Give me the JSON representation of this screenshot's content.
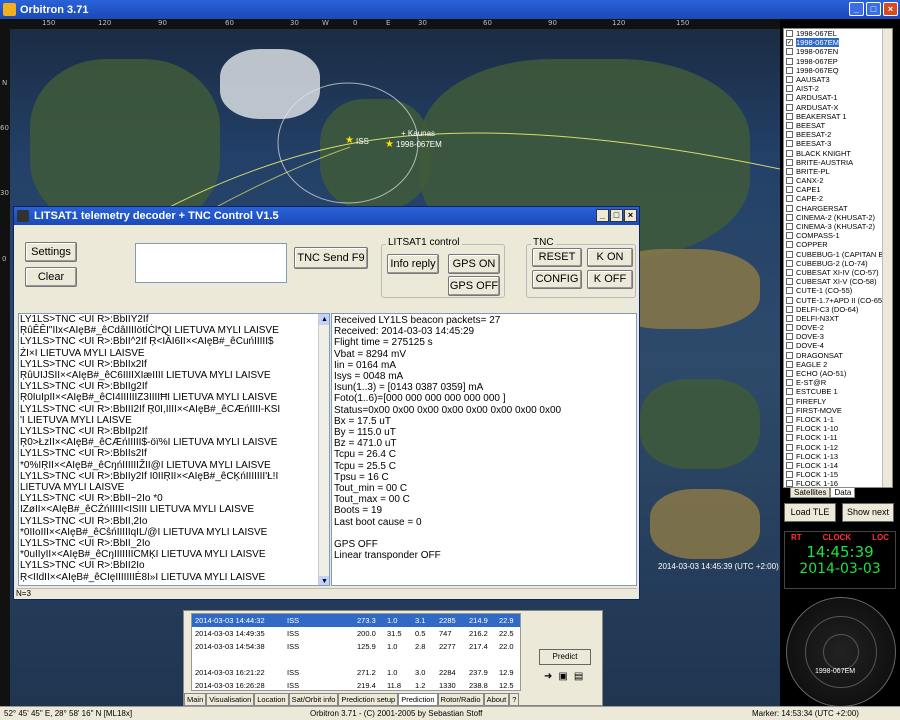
{
  "window": {
    "title": "Orbitron 3.71",
    "buttons": [
      "_",
      "□",
      "×"
    ]
  },
  "map": {
    "top_scale": [
      "150",
      "120",
      "90",
      "60",
      "30",
      "W",
      "0",
      "E",
      "30",
      "60",
      "90",
      "120",
      "150"
    ],
    "left_scale": [
      "N",
      "60",
      "30",
      "0"
    ],
    "labels": {
      "iss": "ISS",
      "kaunas": "Kaunas",
      "sat": "1998-067EM"
    },
    "timestamp": "2014-03-03 14:45:39 (UTC +2:00)"
  },
  "sat_list": {
    "items": [
      "1998-067EL",
      "1998-067EM",
      "1998-067EN",
      "1998-067EP",
      "1998-067EQ",
      "AAUSAT3",
      "AIST-2",
      "ARDUSAT-1",
      "ARDUSAT-X",
      "BEAKERSAT 1",
      "BEESAT",
      "BEESAT-2",
      "BEESAT-3",
      "BLACK KNIGHT",
      "BRITE-AUSTRIA",
      "BRITE-PL",
      "CANX-2",
      "CAPE1",
      "CAPE-2",
      "CHARGERSAT",
      "CINEMA-2 (KHUSAT-2)",
      "CINEMA-3 (KHUSAT-2)",
      "COMPASS-1",
      "COPPER",
      "CUBEBUG-1 (CAPITAN B",
      "CUBEBUG-2 (LO-74)",
      "CUBESAT XI-IV (CO-57)",
      "CUBESAT XI-V (CO-58)",
      "CUTE-1 (CO-55)",
      "CUTE-1.7+APD II (CO-65)",
      "DELFI-C3 (DO-64)",
      "DELFI-N3XT",
      "DOVE-2",
      "DOVE-3",
      "DOVE-4",
      "DRAGONSAT",
      "EAGLE 2",
      "ECHO (AO-51)",
      "E-ST@R",
      "ESTCUBE 1",
      "FIREFLY",
      "FIRST-MOVE",
      "FLOCK 1-1",
      "FLOCK 1-10",
      "FLOCK 1-11",
      "FLOCK 1-12",
      "FLOCK 1-13",
      "FLOCK 1-14",
      "FLOCK 1-15",
      "FLOCK 1-16"
    ],
    "checked_index": 1,
    "selected_index": 1,
    "tabs": [
      "Satellites",
      "Data"
    ]
  },
  "right_buttons": {
    "load_tle": "Load TLE",
    "show_next": "Show next"
  },
  "clock": {
    "rt": "RT",
    "clock": "CLOCK",
    "loc": "LOC",
    "time": "14:45:39",
    "date": "2014-03-03"
  },
  "radar_label": "1998-067EM",
  "status_bar": {
    "coords": "52° 45' 45\" E, 28° 58' 16\" N [ML18x]",
    "app": "Orbitron 3.71 - (C) 2001-2005 by Sebastian Stoff",
    "marker": "Marker: 14:53:34 (UTC +2:00)"
  },
  "prediction": {
    "rows": [
      [
        "2014-03-03 14:44:32",
        "ISS",
        "273.3",
        "1.0",
        "3.1",
        "2285",
        "214.9",
        "22.9"
      ],
      [
        "2014-03-03 14:49:35",
        "ISS",
        "200.0",
        "31.5",
        "0.5",
        "747",
        "216.2",
        "22.5"
      ],
      [
        "2014-03-03 14:54:38",
        "ISS",
        "125.9",
        "1.0",
        "2.8",
        "2277",
        "217.4",
        "22.0"
      ],
      [
        "",
        "",
        "",
        "",
        "",
        "",
        "",
        ""
      ],
      [
        "2014-03-03 16:21:22",
        "ISS",
        "271.2",
        "1.0",
        "3.0",
        "2284",
        "237.9",
        "12.9"
      ],
      [
        "2014-03-03 16:26:28",
        "ISS",
        "219.4",
        "11.8",
        "1.2",
        "1330",
        "238.8",
        "12.5"
      ]
    ],
    "selected_row": 0,
    "predict_btn": "Predict",
    "tabs": [
      "Main",
      "Visualisation",
      "Location",
      "Sat/Orbit info",
      "Prediction setup",
      "Prediction",
      "Rotor/Radio",
      "About",
      "?"
    ],
    "active_tab": 5
  },
  "dialog": {
    "title": "LITSAT1 telemetry decoder + TNC Control V1.5",
    "settings_btn": "Settings",
    "clear_btn": "Clear",
    "tnc_send_btn": "TNC Send F9",
    "litsat_group": "LITSAT1 control",
    "info_reply_btn": "Info reply",
    "gps_on_btn": "GPS ON",
    "gps_off_btn": "GPS OFF",
    "tnc_group": "TNC",
    "reset_btn": "RESET",
    "k_on_btn": "K ON",
    "config_btn": "CONFIG",
    "k_off_btn": "K OFF",
    "status": "N=3",
    "log": [
      "LY1LS>TNC <UI R>:BbIIY2If",
      "ŖûÊÊI\"IIx<AIęB#_êCdâIIIIötÍĊl*QI LIETUVA MYLI LAISVE",
      "LY1LS>TNC <UI R>:BbII^2If Ŗ<IÂI6II×<AIęB#_êCuńIIIII$",
      "ŹI×I LIETUVA MYLI LAISVE",
      "LY1LS>TNC <UI R>:BbIIx2If",
      "ŖûUIJSII×<AIęB#_êC6IIIIXIæIIII LIETUVA MYLI LAISVE",
      "LY1LS>TNC <UI R>:BbIIg2If",
      "Ŗ0IuIpII×<AIęB#_êCI4IIIIIIZ3IIIIĦI LIETUVA MYLI LAISVE",
      "LY1LS>TNC <UI R>:BbIII2If Ŗ0I,IIII×<AIęB#_êCÆńIIII-KSI",
      "'I LIETUVA MYLI LAISVE",
      "LY1LS>TNC <UI R>:BbIIp2If",
      "Ŗ0>ŁzII×<AIęB#_êCÆńIIIII$-öï%I LIETUVA MYLI LAISVE",
      "LY1LS>TNC <UI R>:BbIIs2If",
      "*0%IŖII×<AIęB#_êCŋńIIIIIIŽII@I LIETUVA MYLI LAISVE",
      "LY1LS>TNC <UI R>:BbIIy2If I0IIŖII×<AIęB#_êCĶńIIIIIII'Ł!I",
      "LIETUVA MYLI LAISVE",
      "LY1LS>TNC <UI R>:BbII~2Io *0",
      "IZøII×<AIęB#_êCŹńIIIII<ISIII LIETUVA MYLI LAISVE",
      "LY1LS>TNC <UI R>:BbII,2Io",
      "*0IIoIII×<AIęB#_êCŝńIIIIIqIL/@I LIETUVA MYLI LAISVE",
      "LY1LS>TNC <UI R>:BbII_2Io",
      "*0uIIyII×<AIęB#_êCŋIIIIIIICMĶI LIETUVA MYLI LAISVE",
      "LY1LS>TNC <UI R>:BbII2Io",
      "Ŗ<IIdII×<AIęB#_êCIęIIIIIIIĖ8I»I LIETUVA MYLI LAISVE"
    ],
    "info": [
      "Received LY1LS beacon packets= 27",
      "Received:  2014-03-03 14:45:29",
      "Flight time = 275125 s",
      "Vbat = 8294 mV",
      "Iin = 0164 mA",
      "Isys = 0048 mA",
      "Isun(1..3) = [0143  0387  0359] mA",
      "Foto(1..6)=[000 000 000 000 000 000 ]",
      "Status=0x00 0x00 0x00 0x00 0x00 0x00 0x00 0x00",
      "Bx = 17.5 uT",
      "By = 115.0 uT",
      "Bz = 471.0 uT",
      "Tcpu = 26.4 C",
      "Tcpu = 25.5 C",
      "Tpsu = 16 C",
      "Tout_min = 00 C",
      "Tout_max = 00 C",
      "Boots = 19",
      "Last boot cause = 0",
      "",
      "GPS OFF",
      "Linear transponder OFF"
    ]
  }
}
